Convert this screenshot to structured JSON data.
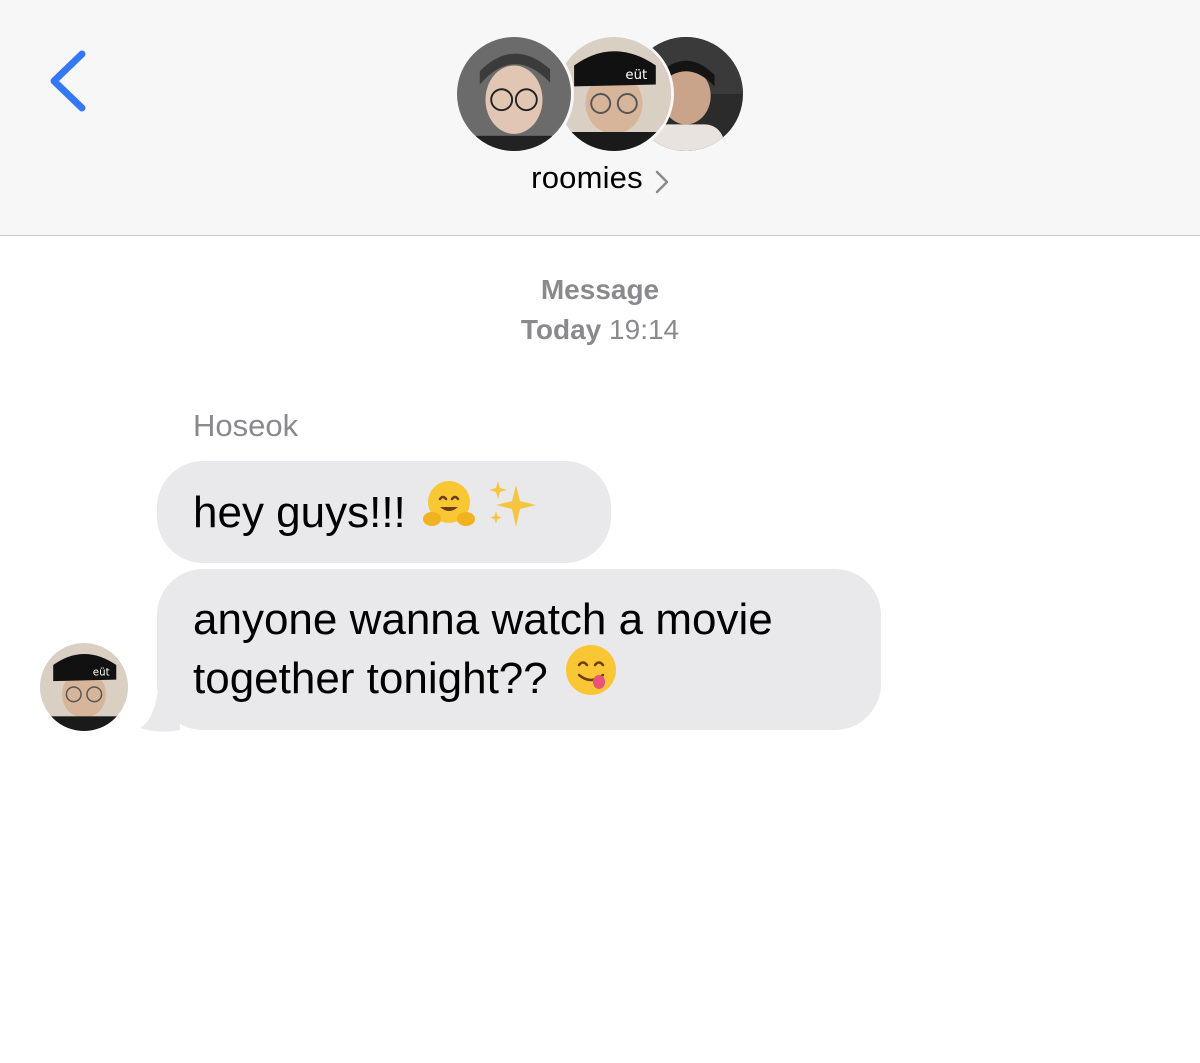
{
  "header": {
    "group_name": "roomies",
    "avatars": [
      {
        "name": "member-1-avatar"
      },
      {
        "name": "member-2-avatar"
      },
      {
        "name": "member-3-avatar"
      }
    ]
  },
  "thread": {
    "service_label": "Message",
    "day_label": "Today",
    "time": "19:14"
  },
  "messages": [
    {
      "sender": "Hoseok",
      "text": "hey guys!!!",
      "emojis": [
        "hugging-face-emoji",
        "sparkles-emoji"
      ]
    },
    {
      "sender": "Hoseok",
      "text": "anyone wanna watch a movie together tonight??",
      "emojis": [
        "face-savoring-food-emoji"
      ]
    }
  ],
  "colors": {
    "accent": "#3478f6",
    "bubble_received": "#e9e9eb",
    "header_bg": "#f7f7f7",
    "secondary_text": "#8a8a8e"
  }
}
